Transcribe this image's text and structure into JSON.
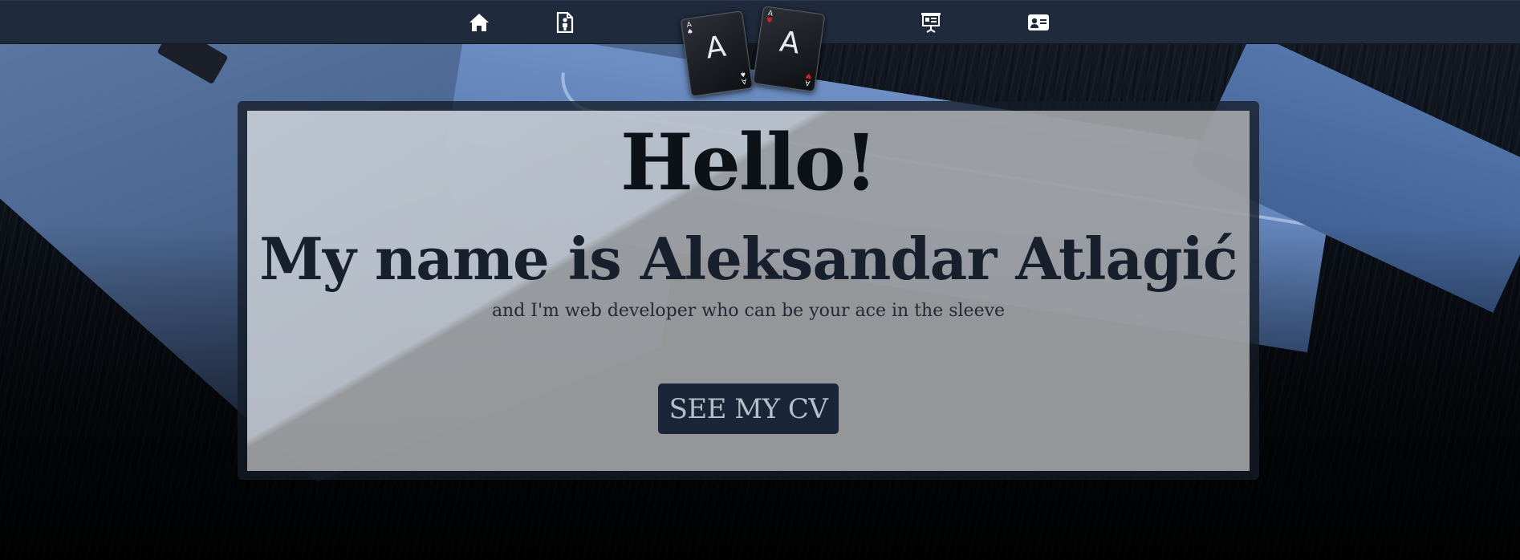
{
  "nav": {
    "items": [
      {
        "id": "home",
        "icon": "home-icon"
      },
      {
        "id": "about",
        "icon": "person-file-icon"
      },
      {
        "id": "portfolio",
        "icon": "presentation-board-icon"
      },
      {
        "id": "contact",
        "icon": "contact-card-icon"
      }
    ],
    "background_color": "#1f2a3c",
    "icon_color": "#ffffff"
  },
  "logo": {
    "left_card": {
      "letter": "A",
      "suit": "♠",
      "suit_color": "#e8eaee"
    },
    "right_card": {
      "letter": "A",
      "suit": "♥",
      "suit_color": "#d4222a"
    }
  },
  "hero": {
    "greeting": "Hello!",
    "name_line": "My name is Aleksandar Atlagić",
    "tagline": "and I'm web developer who can be your ace in the sleeve",
    "cta_label": "SEE MY CV"
  },
  "colors": {
    "button_bg": "#1a2638",
    "button_text": "#b4bdca",
    "heading_text": "#0d1118"
  }
}
